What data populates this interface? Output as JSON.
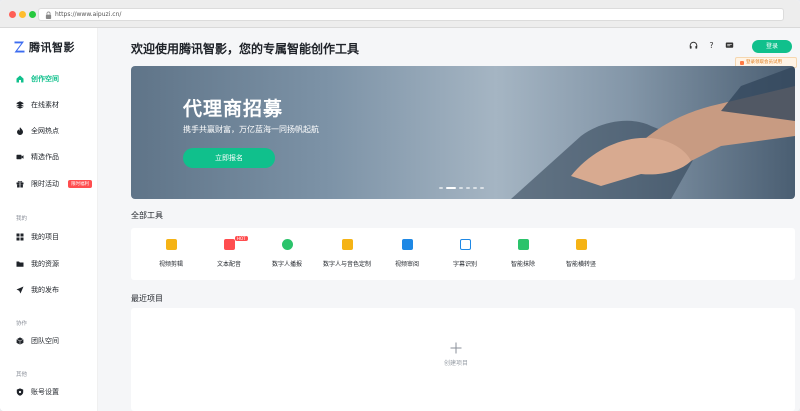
{
  "browser": {
    "url": "https://www.aipuzi.cn/"
  },
  "brand": {
    "name": "腾讯智影",
    "accent": "#10c08c"
  },
  "sidebar": {
    "items_top": [
      {
        "label": "创作空间",
        "icon": "home-icon",
        "active": true
      },
      {
        "label": "在线素材",
        "icon": "layers-icon"
      },
      {
        "label": "全网热点",
        "icon": "flame-icon"
      },
      {
        "label": "精选作品",
        "icon": "video-icon"
      },
      {
        "label": "限时活动",
        "icon": "gift-icon",
        "badge": "限时福利"
      }
    ],
    "section_mine": "我的",
    "items_mine": [
      {
        "label": "我的项目",
        "icon": "grid-icon"
      },
      {
        "label": "我的资源",
        "icon": "folder-icon"
      },
      {
        "label": "我的发布",
        "icon": "send-icon"
      }
    ],
    "section_collab": "协作",
    "items_collab": [
      {
        "label": "团队空间",
        "icon": "cube-icon"
      }
    ],
    "section_other": "其他",
    "items_other": [
      {
        "label": "账号设置",
        "icon": "shield-icon"
      }
    ]
  },
  "header": {
    "title": "欢迎使用腾讯智影，您的专属智能创作工具",
    "login": "登录",
    "tooltip": "登录领取会员试用"
  },
  "banner": {
    "title": "代理商招募",
    "subtitle": "携手共赢财富，万亿蓝海一同扬帆起航",
    "button": "立即报名"
  },
  "tools": {
    "title": "全部工具",
    "items": [
      {
        "label": "视频剪辑",
        "icon": "video-edit-icon",
        "color": "#f5b315"
      },
      {
        "label": "文本配音",
        "icon": "text-voice-icon",
        "color": "#ff4d4f",
        "badge": "HOT"
      },
      {
        "label": "数字人播报",
        "icon": "avatar-icon",
        "color": "#2bc36b"
      },
      {
        "label": "数字人与音色定制",
        "icon": "custom-icon",
        "color": "#f5b315"
      },
      {
        "label": "视频审阅",
        "icon": "review-icon",
        "color": "#1e88e5"
      },
      {
        "label": "字幕识别",
        "icon": "subtitle-icon",
        "color": "#1e88e5"
      },
      {
        "label": "智能抹除",
        "icon": "erase-icon",
        "color": "#2bc36b"
      },
      {
        "label": "智能横转竖",
        "icon": "rotate-icon",
        "color": "#f5b315"
      }
    ]
  },
  "recent": {
    "title": "最近项目",
    "new_label": "创建项目"
  }
}
